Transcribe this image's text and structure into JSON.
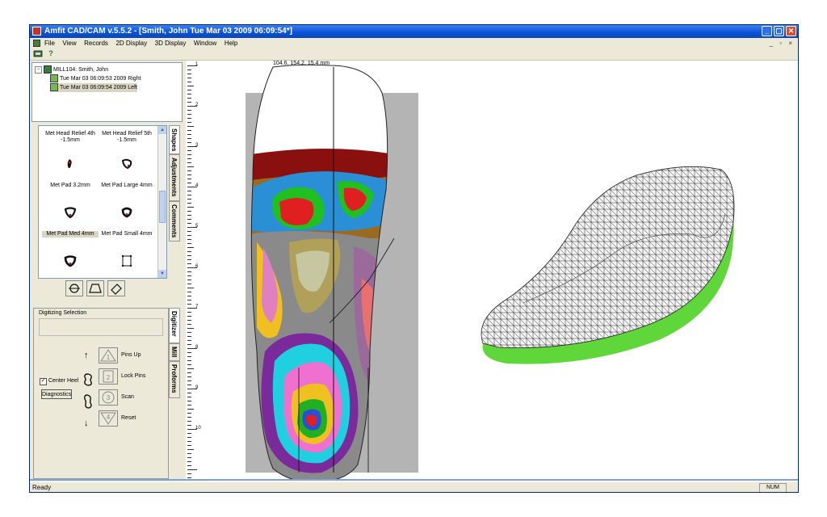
{
  "window": {
    "title": "Amfit CAD/CAM v.5.5.2 - [Smith, John  Tue Mar 03 2009 06:09:54*]",
    "controls": [
      "_",
      "▢",
      "✕"
    ]
  },
  "menu": {
    "items": [
      "File",
      "View",
      "Records",
      "2D Display",
      "3D Display",
      "Window",
      "Help"
    ],
    "mdi_controls": "_ ▫ ×"
  },
  "toolbar": {
    "buttons": [
      "mill-icon",
      "help-icon"
    ],
    "help_glyph": "?"
  },
  "tree": {
    "patient": "MILL104: Smith, John",
    "scans": [
      "Tue Mar 03 06:09:53 2009 Right",
      "Tue Mar 03 06:09:54 2009 Left"
    ],
    "expander": "−"
  },
  "shapes": {
    "items": [
      "Met Head Relief 4th -1.5mm",
      "Met Head Relief 5th -1.5mm",
      "Met Pad 3.2mm",
      "Met Pad Large 4mm",
      "Met Pad Med 4mm",
      "Met Pad Small 4mm"
    ],
    "label_lines": [
      [
        "Met Head Relief 4th",
        "-1.5mm"
      ],
      [
        "Met Head Relief 5th",
        "-1.5mm"
      ],
      [
        "Met Pad 3.2mm"
      ],
      [
        "Met Pad Large 4mm"
      ],
      [
        "Met Pad Med 4mm"
      ],
      [
        "Met Pad Small 4mm"
      ]
    ],
    "scroll_up": "▲",
    "scroll_down": "▼"
  },
  "side_tabs_top": [
    "Shapes",
    "Adjustments",
    "Comments"
  ],
  "side_tabs_bottom": [
    "Digitizer",
    "Mill",
    "Proforms"
  ],
  "digitizing": {
    "title": "Digitizing Selection",
    "center_heel_label": "Center Heel",
    "center_heel_checked": "✓",
    "diagnostics_label": "Diagnostics",
    "buttons": [
      {
        "label": "Pins Up",
        "glyph": "1"
      },
      {
        "label": "Lock Pins",
        "glyph": "2"
      },
      {
        "label": "Scan",
        "glyph": "3"
      },
      {
        "label": "Reset",
        "glyph": "4"
      }
    ],
    "arrow_up": "↑",
    "arrow_down": "↓"
  },
  "ruler": {
    "labels": [
      "1",
      "2",
      "3",
      "4",
      "5",
      "6",
      "7",
      "8",
      "9",
      "10"
    ]
  },
  "viewer": {
    "coordinate_readout": "104.6, 154.2, 15.4 mm"
  },
  "colors": {
    "titlebar": "#0a52d6",
    "insole_green": "#5fd63a",
    "mesh_line": "#2a2a2a"
  },
  "status": {
    "text": "Ready",
    "num_indicator": "NUM"
  }
}
